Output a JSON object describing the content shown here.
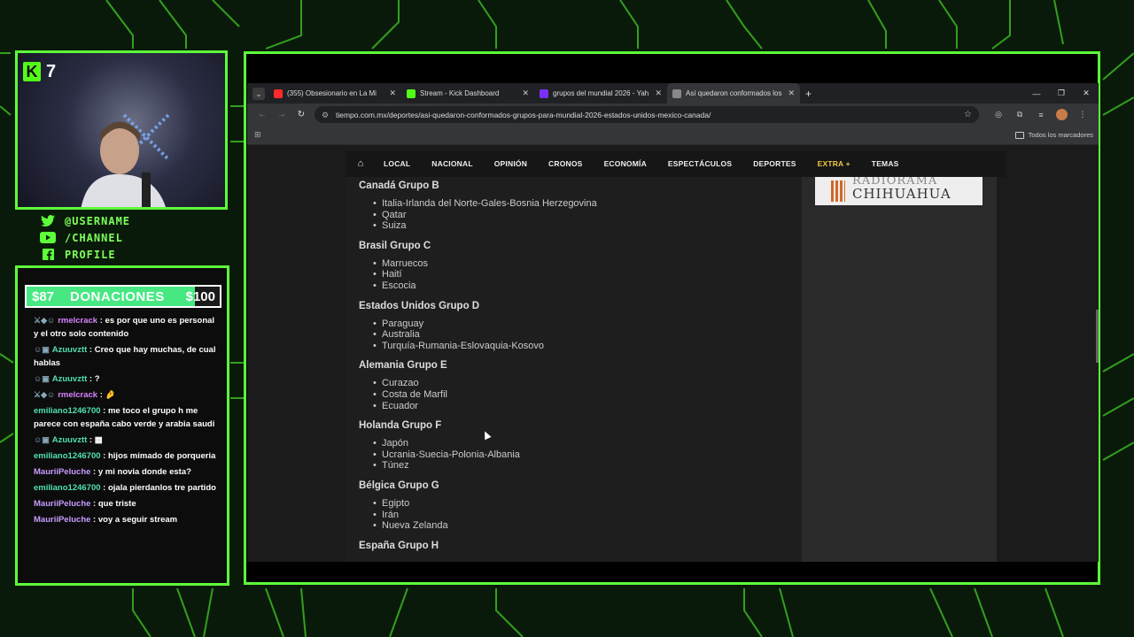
{
  "overlay": {
    "viewer_count": "7",
    "socials": [
      {
        "icon": "twitter-icon",
        "label": "@USERNAME"
      },
      {
        "icon": "youtube-icon",
        "label": "/CHANNEL"
      },
      {
        "icon": "facebook-icon",
        "label": "PROFILE"
      }
    ],
    "donations": {
      "current": "$87",
      "label": "DONACIONES",
      "goal": "$100",
      "progress": 0.87
    },
    "chat": [
      {
        "user": "rmelcrack",
        "color": "#d982ff",
        "text": "es por que uno es personal y el otro solo contenido",
        "badges": "⚔◆☺"
      },
      {
        "user": "Azuuvztt",
        "color": "#4fe0b3",
        "text": "Creo que hay muchas, de cual hablas",
        "badges": "☺▣"
      },
      {
        "user": "Azuuvztt",
        "color": "#4fe0b3",
        "text": "?",
        "badges": "☺▣"
      },
      {
        "user": "rmelcrack",
        "color": "#d982ff",
        "text": "🤌",
        "badges": "⚔◆☺"
      },
      {
        "user": "emiliano1246700",
        "color": "#4fe0b3",
        "text": "me toco el grupo h me parece con españa cabo verde y arabia saudi",
        "badges": ""
      },
      {
        "user": "Azuuvztt",
        "color": "#4fe0b3",
        "text": "▦",
        "badges": "☺▣"
      },
      {
        "user": "emiliano1246700",
        "color": "#4fe0b3",
        "text": "hijos mimado de porqueria",
        "badges": ""
      },
      {
        "user": "MauriiPeluche",
        "color": "#c79cff",
        "text": "y mi novia donde esta?",
        "badges": ""
      },
      {
        "user": "emiliano1246700",
        "color": "#4fe0b3",
        "text": "ojala pierdanlos tre partido",
        "badges": ""
      },
      {
        "user": "MauriiPeluche",
        "color": "#c79cff",
        "text": "que triste",
        "badges": ""
      },
      {
        "user": "MauriiPeluche",
        "color": "#c79cff",
        "text": "voy a seguir stream",
        "badges": ""
      }
    ]
  },
  "browser": {
    "tabs": [
      {
        "title": "(355) Obsesionario en La Mi",
        "favicon_color": "#ff2a2a",
        "active": false
      },
      {
        "title": "Stream - Kick Dashboard",
        "favicon_color": "#53fc18",
        "active": false
      },
      {
        "title": "grupos del mundial 2026 - Yah",
        "favicon_color": "#7b2fff",
        "active": false
      },
      {
        "title": "Así quedaron conformados los",
        "favicon_color": "#888888",
        "active": true
      }
    ],
    "url": "tiempo.com.mx/deportes/asi-quedaron-conformados-grupos-para-mundial-2026-estados-unidos-mexico-canada/",
    "bookmarks_all": "Todos los marcadores"
  },
  "site": {
    "nav": [
      "LOCAL",
      "NACIONAL",
      "OPINIÓN",
      "CRONOS",
      "ECONOMÍA",
      "ESPECTÁCULOS",
      "DEPORTES",
      "EXTRA +",
      "TEMAS"
    ],
    "ad_top": "RADIORAMA",
    "ad_name": "CHIHUAHUA",
    "groups": [
      {
        "title": "Canadá Grupo B",
        "teams": [
          "Italia-Irlanda del Norte-Gales-Bosnia Herzegovina",
          "Qatar",
          "Suiza"
        ]
      },
      {
        "title": "Brasil Grupo C",
        "teams": [
          "Marruecos",
          "Haití",
          "Escocia"
        ]
      },
      {
        "title": "Estados Unidos Grupo D",
        "teams": [
          "Paraguay",
          "Australia",
          "Turquía-Rumania-Eslovaquia-Kosovo"
        ]
      },
      {
        "title": "Alemania Grupo E",
        "teams": [
          "Curazao",
          "Costa de Marfil",
          "Ecuador"
        ]
      },
      {
        "title": "Holanda Grupo F",
        "teams": [
          "Japón",
          "Ucrania-Suecia-Polonia-Albania",
          "Túnez"
        ]
      },
      {
        "title": "Bélgica Grupo G",
        "teams": [
          "Egipto",
          "Irán",
          "Nueva Zelanda"
        ]
      },
      {
        "title": "España Grupo H",
        "teams": []
      }
    ]
  },
  "colors": {
    "accent": "#5dff3a",
    "donation_fill": "#47e882"
  }
}
